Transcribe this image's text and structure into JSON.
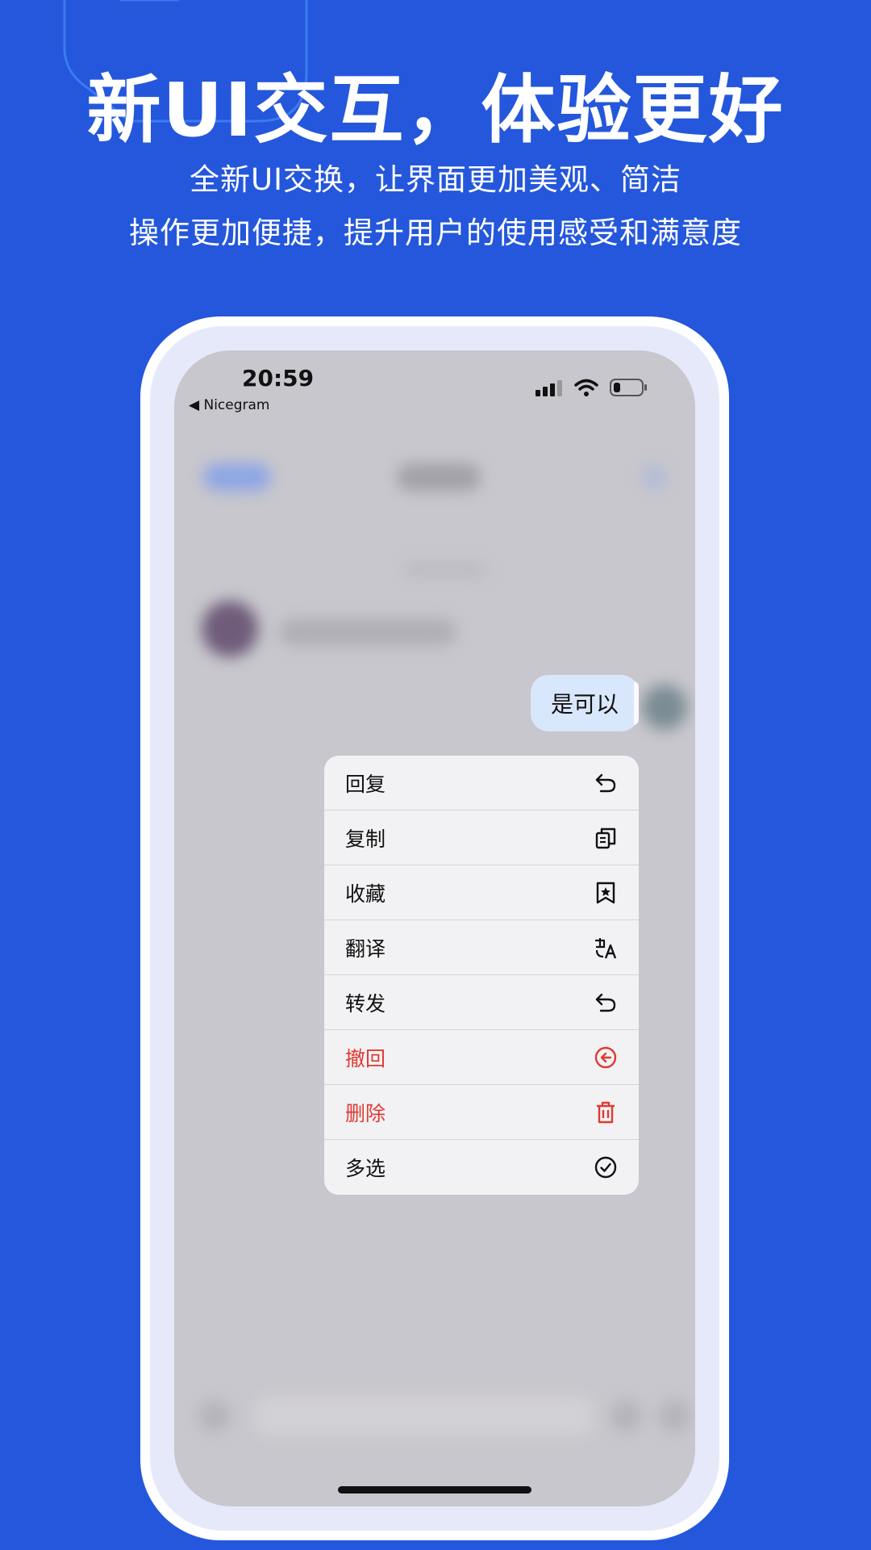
{
  "promo": {
    "headline": "新UI交互，体验更好",
    "subtitle_line1": "全新UI交换，让界面更加美观、简洁",
    "subtitle_line2": "操作更加便捷，提升用户的使用感受和满意度"
  },
  "status_bar": {
    "time": "20:59",
    "back_app": "◀ Nicegram"
  },
  "message": {
    "text": "是可以"
  },
  "context_menu": {
    "items": [
      {
        "label": "回复",
        "icon": "reply-icon",
        "danger": false
      },
      {
        "label": "复制",
        "icon": "copy-icon",
        "danger": false
      },
      {
        "label": "收藏",
        "icon": "bookmark-star-icon",
        "danger": false
      },
      {
        "label": "翻译",
        "icon": "translate-icon",
        "danger": false
      },
      {
        "label": "转发",
        "icon": "forward-icon",
        "danger": false
      },
      {
        "label": "撤回",
        "icon": "recall-icon",
        "danger": true
      },
      {
        "label": "删除",
        "icon": "trash-icon",
        "danger": true
      },
      {
        "label": "多选",
        "icon": "check-circle-icon",
        "danger": false
      }
    ]
  },
  "colors": {
    "background": "#2457DB",
    "danger": "#E03A34",
    "bubble": "#D9E7FD",
    "menu": "#F2F2F4"
  }
}
